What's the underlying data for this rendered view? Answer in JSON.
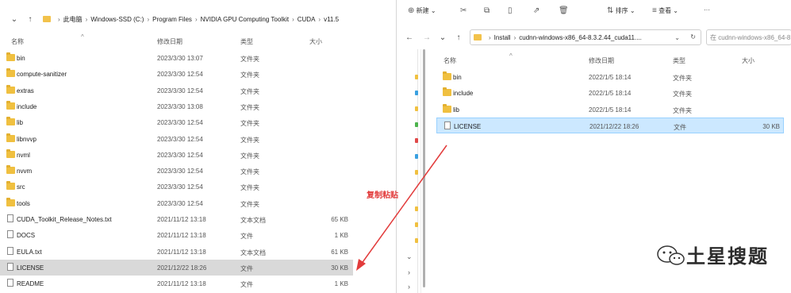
{
  "left": {
    "path": [
      "此电脑",
      "Windows-SSD (C:)",
      "Program Files",
      "NVIDIA GPU Computing Toolkit",
      "CUDA",
      "v11.5"
    ],
    "columns": {
      "name": "名称",
      "date": "修改日期",
      "type": "类型",
      "size": "大小"
    },
    "rows": [
      {
        "name": "bin",
        "date": "2023/3/30 13:07",
        "type": "文件夹",
        "size": "",
        "kind": "folder"
      },
      {
        "name": "compute-sanitizer",
        "date": "2023/3/30 12:54",
        "type": "文件夹",
        "size": "",
        "kind": "folder"
      },
      {
        "name": "extras",
        "date": "2023/3/30 12:54",
        "type": "文件夹",
        "size": "",
        "kind": "folder"
      },
      {
        "name": "include",
        "date": "2023/3/30 13:08",
        "type": "文件夹",
        "size": "",
        "kind": "folder"
      },
      {
        "name": "lib",
        "date": "2023/3/30 12:54",
        "type": "文件夹",
        "size": "",
        "kind": "folder"
      },
      {
        "name": "libnvvp",
        "date": "2023/3/30 12:54",
        "type": "文件夹",
        "size": "",
        "kind": "folder"
      },
      {
        "name": "nvml",
        "date": "2023/3/30 12:54",
        "type": "文件夹",
        "size": "",
        "kind": "folder"
      },
      {
        "name": "nvvm",
        "date": "2023/3/30 12:54",
        "type": "文件夹",
        "size": "",
        "kind": "folder"
      },
      {
        "name": "src",
        "date": "2023/3/30 12:54",
        "type": "文件夹",
        "size": "",
        "kind": "folder"
      },
      {
        "name": "tools",
        "date": "2023/3/30 12:54",
        "type": "文件夹",
        "size": "",
        "kind": "folder"
      },
      {
        "name": "CUDA_Toolkit_Release_Notes.txt",
        "date": "2021/11/12 13:18",
        "type": "文本文档",
        "size": "65 KB",
        "kind": "file"
      },
      {
        "name": "DOCS",
        "date": "2021/11/12 13:18",
        "type": "文件",
        "size": "1 KB",
        "kind": "file"
      },
      {
        "name": "EULA.txt",
        "date": "2021/11/12 13:18",
        "type": "文本文档",
        "size": "61 KB",
        "kind": "file"
      },
      {
        "name": "LICENSE",
        "date": "2021/12/22 18:26",
        "type": "文件",
        "size": "30 KB",
        "kind": "file",
        "selected": true
      },
      {
        "name": "README",
        "date": "2021/11/12 13:18",
        "type": "文件",
        "size": "1 KB",
        "kind": "file"
      }
    ]
  },
  "right": {
    "toolbar": {
      "new": "新建",
      "sort": "排序",
      "view": "查看",
      "more": "···"
    },
    "path": [
      "Install",
      "cudnn-windows-x86_64-8.3.2.44_cuda11...."
    ],
    "search_placeholder": "在 cudnn-windows-x86_64-8...",
    "columns": {
      "name": "名称",
      "date": "修改日期",
      "type": "类型",
      "size": "大小"
    },
    "rows": [
      {
        "name": "bin",
        "date": "2022/1/5 18:14",
        "type": "文件夹",
        "size": "",
        "kind": "folder"
      },
      {
        "name": "include",
        "date": "2022/1/5 18:14",
        "type": "文件夹",
        "size": "",
        "kind": "folder"
      },
      {
        "name": "lib",
        "date": "2022/1/5 18:14",
        "type": "文件夹",
        "size": "",
        "kind": "folder"
      },
      {
        "name": "LICENSE",
        "date": "2021/12/22 18:26",
        "type": "文件",
        "size": "30 KB",
        "kind": "file",
        "selected": true
      }
    ]
  },
  "annotation": {
    "text": "复制粘贴",
    "color": "#e23b3b"
  },
  "watermark": {
    "text": "土星搜题"
  }
}
